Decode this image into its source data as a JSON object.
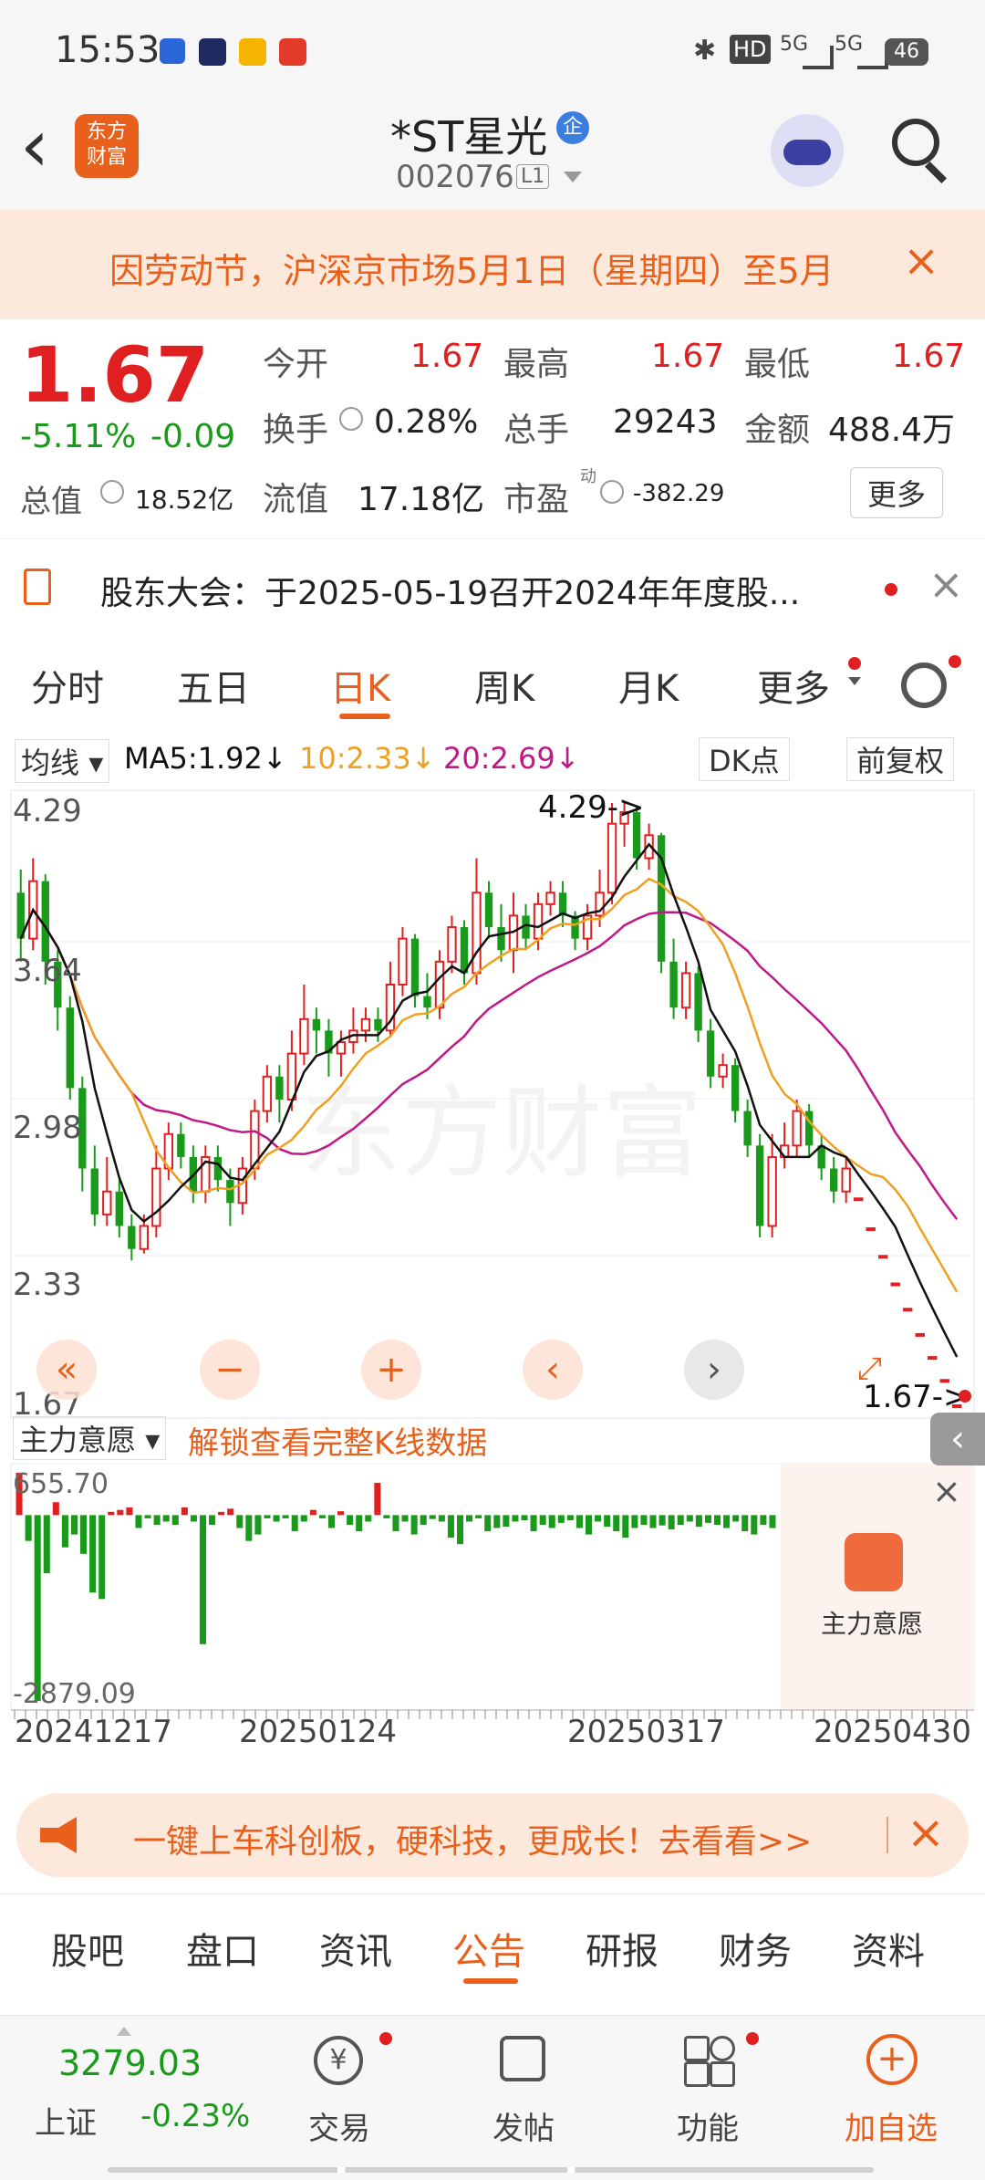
{
  "status": {
    "time": "15:53",
    "battery": "46",
    "net1": "5G",
    "net2": "5G",
    "hd": "HD"
  },
  "header": {
    "back": "‹",
    "logo": "东方\n财富",
    "name": "*ST星光",
    "badge": "企",
    "code": "002076",
    "level": "L1"
  },
  "notice": {
    "text": "因劳动节，沪深京市场5月1日（星期四）至5月",
    "close": "×"
  },
  "quote": {
    "price": "1.67",
    "pct": "-5.11%",
    "chg": "-0.09",
    "open_label": "今开",
    "open": "1.67",
    "high_label": "最高",
    "high": "1.67",
    "low_label": "最低",
    "low": "1.67",
    "turn_label": "换手",
    "turn": "0.28%",
    "vol_label": "总手",
    "vol": "29243",
    "amt_label": "金额",
    "amt": "488.4万",
    "mcap_label": "总值",
    "mcap": "18.52亿",
    "float_label": "流值",
    "float": "17.18亿",
    "pe_label": "市盈",
    "pe_sup": "动",
    "pe": "-382.29",
    "more": "更多"
  },
  "announce": {
    "text": "股东大会：于2025-05-19召开2024年年度股..."
  },
  "tabs": [
    "分时",
    "五日",
    "日K",
    "周K",
    "月K",
    "更多",
    ""
  ],
  "chart_header": {
    "ma_select": "均线",
    "ma5": "MA5:1.92",
    "ma10": "10:2.33",
    "ma20": "20:2.69",
    "dk": "DK点",
    "fq": "前复权"
  },
  "chart_labels": {
    "y1": "4.29",
    "y2": "3.64",
    "y3": "2.98",
    "y4": "2.33",
    "y5": "1.67",
    "high_mark": "4.29->",
    "last_mark": "1.67->",
    "watermark": "东方财富"
  },
  "sub_chart": {
    "select": "主力意愿",
    "unlock": "解锁查看完整K线数据",
    "ytop": "655.70",
    "ybot": "-2879.09",
    "side_label": "主力意愿",
    "dates": [
      "20241217",
      "20250124",
      "20250317",
      "20250430"
    ]
  },
  "banner": {
    "text": "一键上车科创板，硬科技，更成长！去看看>>"
  },
  "bottom_tabs": [
    "股吧",
    "盘口",
    "资讯",
    "公告",
    "研报",
    "财务",
    "资料"
  ],
  "footer": {
    "index_value": "3279.03",
    "index_name": "上证",
    "index_pct": "-0.23%",
    "trade": "交易",
    "post": "发帖",
    "func": "功能",
    "add": "加自选"
  },
  "colors": {
    "accent": "#e8601c",
    "up": "#e02020",
    "down": "#1a9a1a",
    "ma5": "#111111",
    "ma10": "#f0a020",
    "ma20": "#c01888"
  },
  "chart_data": {
    "type": "candlestick",
    "ylim": [
      1.67,
      4.29
    ],
    "y_ticks": [
      4.29,
      3.64,
      2.98,
      2.33,
      1.67
    ],
    "x_ticks": [
      "20241217",
      "20250124",
      "20250317",
      "20250430"
    ],
    "candles": [
      [
        3.9,
        3.7,
        4.0,
        3.6
      ],
      [
        3.7,
        3.95,
        4.05,
        3.65
      ],
      [
        3.95,
        3.6,
        3.98,
        3.5
      ],
      [
        3.6,
        3.4,
        3.65,
        3.3
      ],
      [
        3.4,
        3.05,
        3.45,
        3.0
      ],
      [
        3.05,
        2.7,
        3.1,
        2.6
      ],
      [
        2.7,
        2.5,
        2.8,
        2.45
      ],
      [
        2.5,
        2.6,
        2.75,
        2.45
      ],
      [
        2.6,
        2.45,
        2.65,
        2.4
      ],
      [
        2.45,
        2.35,
        2.5,
        2.3
      ],
      [
        2.35,
        2.45,
        2.5,
        2.33
      ],
      [
        2.45,
        2.7,
        2.8,
        2.4
      ],
      [
        2.7,
        2.85,
        2.9,
        2.65
      ],
      [
        2.85,
        2.75,
        2.9,
        2.7
      ],
      [
        2.75,
        2.6,
        2.8,
        2.55
      ],
      [
        2.6,
        2.75,
        2.8,
        2.55
      ],
      [
        2.75,
        2.65,
        2.8,
        2.6
      ],
      [
        2.65,
        2.55,
        2.7,
        2.45
      ],
      [
        2.55,
        2.7,
        2.75,
        2.5
      ],
      [
        2.7,
        2.95,
        3.0,
        2.65
      ],
      [
        2.95,
        3.1,
        3.15,
        2.9
      ],
      [
        3.1,
        3.0,
        3.15,
        2.9
      ],
      [
        3.0,
        3.2,
        3.3,
        2.95
      ],
      [
        3.2,
        3.35,
        3.5,
        3.15
      ],
      [
        3.35,
        3.3,
        3.4,
        3.2
      ],
      [
        3.3,
        3.2,
        3.35,
        3.1
      ],
      [
        3.2,
        3.25,
        3.3,
        3.1
      ],
      [
        3.25,
        3.3,
        3.4,
        3.2
      ],
      [
        3.3,
        3.35,
        3.4,
        3.25
      ],
      [
        3.35,
        3.3,
        3.4,
        3.25
      ],
      [
        3.3,
        3.5,
        3.6,
        3.28
      ],
      [
        3.5,
        3.7,
        3.75,
        3.45
      ],
      [
        3.7,
        3.45,
        3.72,
        3.4
      ],
      [
        3.45,
        3.4,
        3.55,
        3.35
      ],
      [
        3.4,
        3.6,
        3.65,
        3.35
      ],
      [
        3.6,
        3.75,
        3.8,
        3.55
      ],
      [
        3.75,
        3.55,
        3.78,
        3.5
      ],
      [
        3.55,
        3.9,
        4.05,
        3.5
      ],
      [
        3.9,
        3.75,
        3.95,
        3.7
      ],
      [
        3.75,
        3.65,
        3.85,
        3.6
      ],
      [
        3.65,
        3.8,
        3.9,
        3.55
      ],
      [
        3.8,
        3.7,
        3.85,
        3.65
      ],
      [
        3.7,
        3.85,
        3.9,
        3.65
      ],
      [
        3.85,
        3.9,
        3.95,
        3.8
      ],
      [
        3.9,
        3.8,
        3.95,
        3.75
      ],
      [
        3.8,
        3.7,
        3.82,
        3.65
      ],
      [
        3.7,
        3.8,
        3.85,
        3.65
      ],
      [
        3.8,
        3.9,
        4.0,
        3.75
      ],
      [
        3.9,
        4.2,
        4.29,
        3.85
      ],
      [
        4.2,
        4.25,
        4.29,
        4.1
      ],
      [
        4.25,
        4.05,
        4.28,
        4.0
      ],
      [
        4.05,
        4.15,
        4.2,
        4.0
      ],
      [
        4.15,
        3.6,
        4.16,
        3.55
      ],
      [
        3.6,
        3.4,
        3.7,
        3.35
      ],
      [
        3.4,
        3.55,
        3.6,
        3.35
      ],
      [
        3.55,
        3.3,
        3.58,
        3.25
      ],
      [
        3.3,
        3.1,
        3.35,
        3.05
      ],
      [
        3.1,
        3.15,
        3.2,
        3.05
      ],
      [
        3.15,
        2.95,
        3.18,
        2.9
      ],
      [
        2.95,
        2.8,
        3.0,
        2.75
      ],
      [
        2.8,
        2.45,
        2.85,
        2.4
      ],
      [
        2.45,
        2.75,
        2.85,
        2.4
      ],
      [
        2.75,
        2.8,
        2.9,
        2.7
      ],
      [
        2.8,
        2.95,
        3.0,
        2.75
      ],
      [
        2.95,
        2.8,
        2.98,
        2.75
      ],
      [
        2.8,
        2.7,
        2.85,
        2.65
      ],
      [
        2.7,
        2.6,
        2.75,
        2.55
      ],
      [
        2.6,
        2.7,
        2.75,
        2.55
      ],
      [
        2.57,
        2.57,
        2.57,
        2.57
      ],
      [
        2.44,
        2.44,
        2.44,
        2.44
      ],
      [
        2.32,
        2.32,
        2.32,
        2.32
      ],
      [
        2.2,
        2.2,
        2.2,
        2.2
      ],
      [
        2.09,
        2.09,
        2.09,
        2.09
      ],
      [
        1.98,
        1.98,
        1.98,
        1.98
      ],
      [
        1.88,
        1.88,
        1.88,
        1.88
      ],
      [
        1.78,
        1.78,
        1.78,
        1.78
      ],
      [
        1.67,
        1.67,
        1.67,
        1.67
      ]
    ],
    "sub_values": [
      655.7,
      -400,
      -2879.09,
      -900,
      200,
      -500,
      -300,
      -600,
      -1200,
      -1300,
      50,
      80,
      120,
      -200,
      -50,
      -150,
      -100,
      -150,
      120,
      -100,
      -2000,
      -150,
      50,
      100,
      -200,
      -400,
      -300,
      -50,
      -100,
      -50,
      -250,
      -100,
      80,
      -50,
      -200,
      60,
      -150,
      -250,
      -100,
      500,
      -50,
      -250,
      -100,
      -300,
      -150,
      -60,
      -100,
      -350,
      -450,
      -100,
      -50,
      -250,
      -200,
      -180,
      -100,
      -80,
      -250,
      -150,
      -200,
      -120,
      -80,
      -200,
      -300,
      -100,
      -180,
      -250,
      -350,
      -200,
      -150,
      -200,
      -160,
      -220,
      -150,
      -100,
      -180,
      -120,
      -150,
      -200,
      -100,
      -250,
      -300,
      -150,
      -200
    ]
  }
}
